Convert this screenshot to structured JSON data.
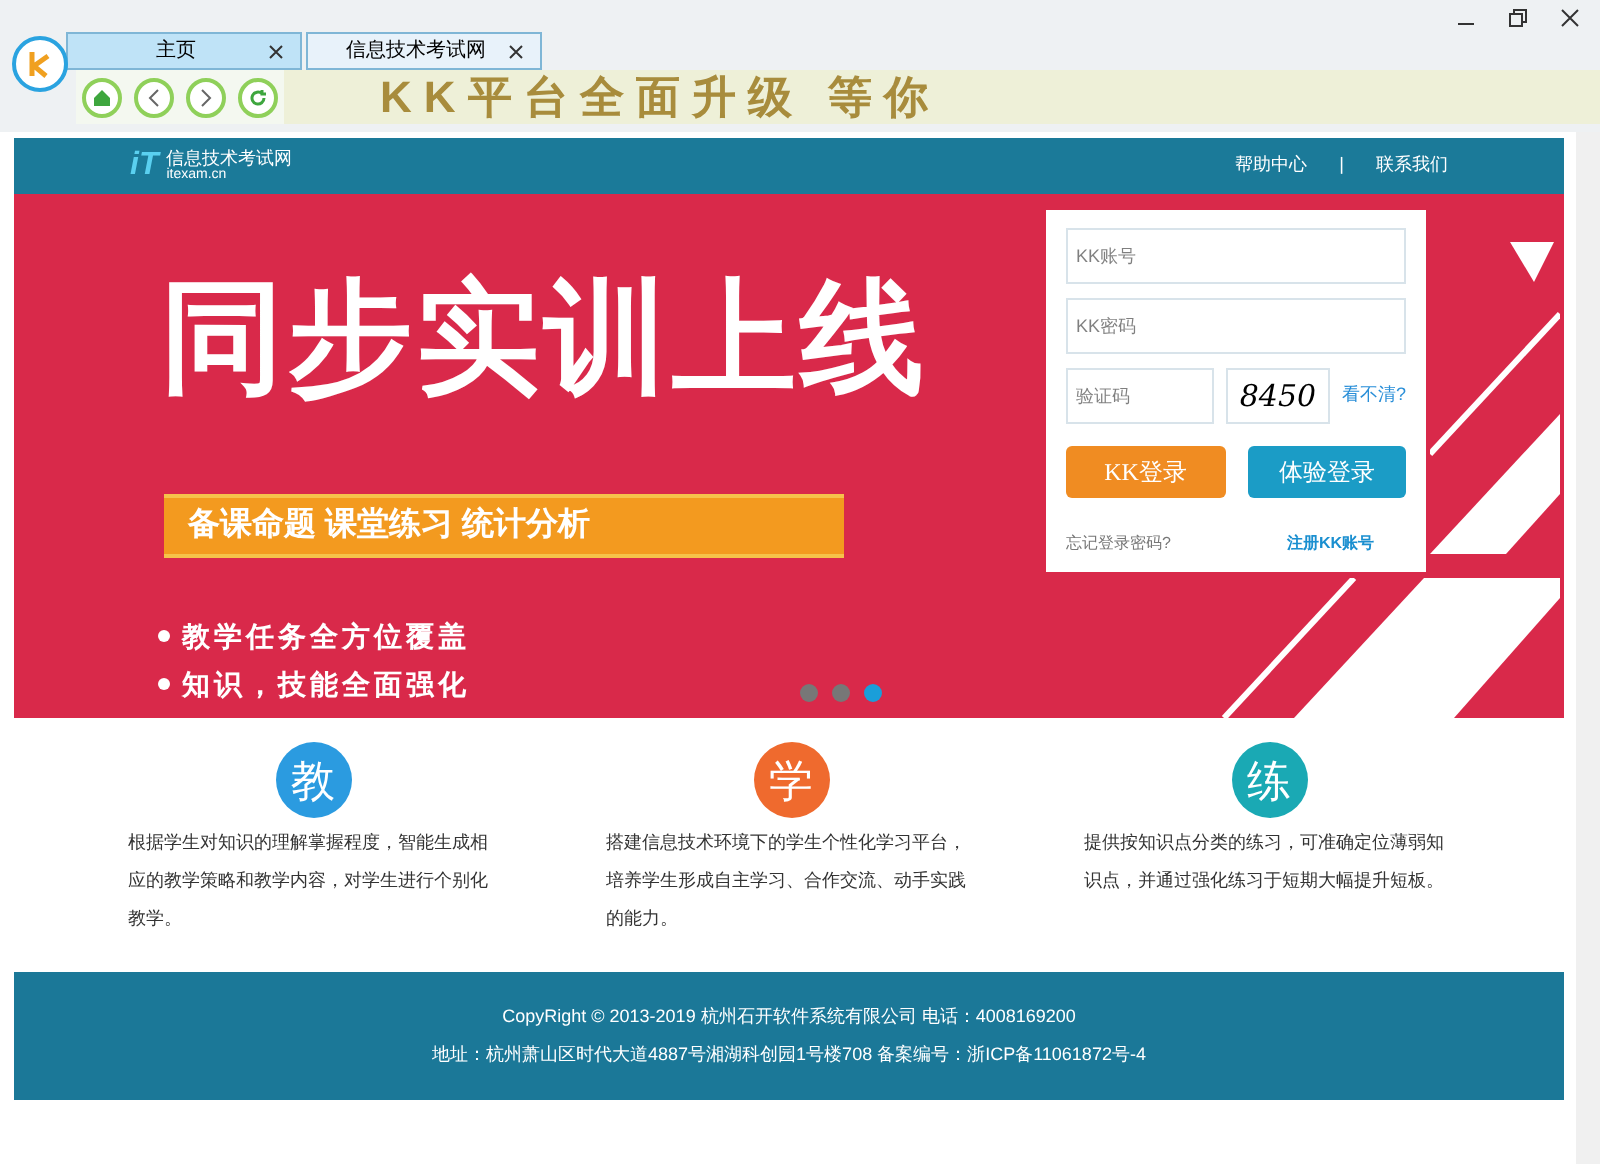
{
  "tabs": [
    {
      "label": "主页",
      "selected": false
    },
    {
      "label": "信息技术考试网",
      "selected": true
    }
  ],
  "ad_banner": {
    "text": "KK平台全面升级  等你"
  },
  "site_header": {
    "logo_mark": "iT",
    "logo_name": "信息技术考试网",
    "logo_url": "itexam.cn",
    "links": [
      "帮助中心",
      "|",
      "联系我们"
    ]
  },
  "hero": {
    "headline": "同步实训上线",
    "ribbon": "备课命题  课堂练习  统计分析",
    "bullets": [
      "教学任务全方位覆盖",
      "知识，技能全面强化"
    ],
    "dots": [
      {
        "selected": false
      },
      {
        "selected": false
      },
      {
        "selected": true
      }
    ]
  },
  "login": {
    "account": {
      "placeholder": "KK账号"
    },
    "password": {
      "placeholder": "KK密码"
    },
    "captcha": {
      "placeholder": "验证码"
    },
    "captcha_code": "8450",
    "refresh": "看不清?",
    "buttons": [
      {
        "label": "KK登录",
        "kind": "orange"
      },
      {
        "label": "体验登录",
        "kind": "blue"
      }
    ],
    "forgot": "忘记登录密码?",
    "register": "注册KK账号"
  },
  "features": [
    {
      "glyph": "教",
      "color": "#2b9be0",
      "text": "根据学生对知识的理解掌握程度，智能生成相应的教学策略和教学内容，对学生进行个别化教学。"
    },
    {
      "glyph": "学",
      "color": "#ef6a2e",
      "text": "搭建信息技术环境下的学生个性化学习平台，培养学生形成自主学习、合作交流、动手实践的能力。"
    },
    {
      "glyph": "练",
      "color": "#1aa9b4",
      "text": "提供按知识点分类的练习，可准确定位薄弱知识点，并通过强化练习于短期大幅提升短板。"
    }
  ],
  "footer": [
    "CopyRight © 2013-2019 杭州石开软件系统有限公司 电话：4008169200",
    "地址：杭州萧山区时代大道4887号湘湖科创园1号楼708 备案编号：浙ICP备11061872号-4"
  ]
}
